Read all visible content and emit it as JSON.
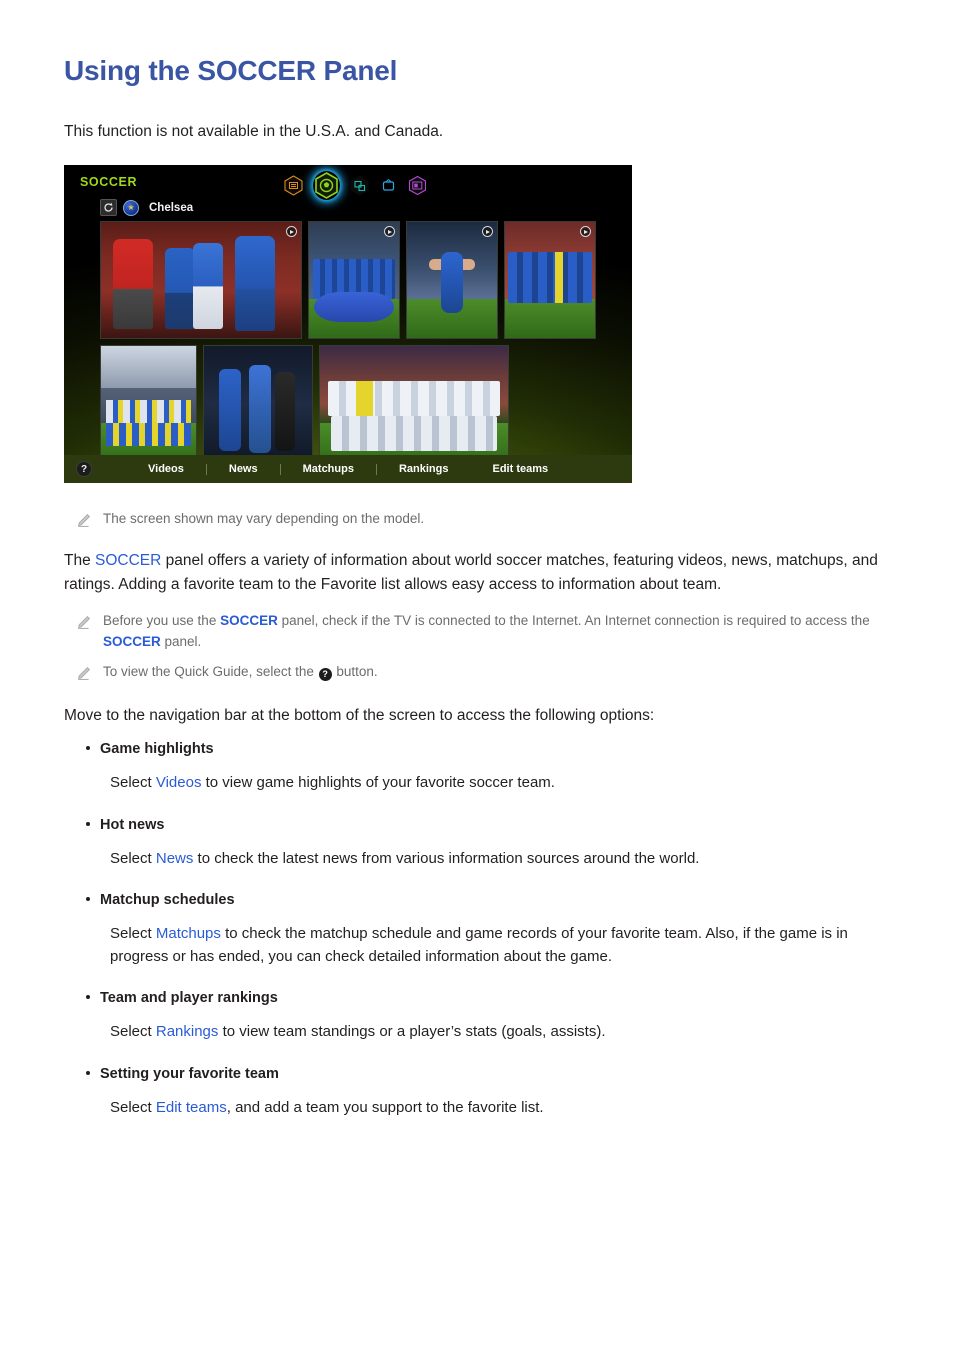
{
  "page": {
    "title": "Using the SOCCER Panel",
    "intro": "This function is not available in the U.S.A. and Canada."
  },
  "accent_colors": {
    "heading_blue": "#3b55a5",
    "link_blue": "#2a5bd7",
    "note_gray": "#6c6c6c",
    "panel_logo_green": "#a2d916",
    "panel_nav_bg": "#2d3a10"
  },
  "tv_panel": {
    "logo": "SOCCER",
    "team_name": "Chelsea",
    "sync_icon": "refresh-icon",
    "crest_icon": "chelsea-crest-icon",
    "header_icons": [
      {
        "name": "news-hex-icon",
        "color": "#e08a16",
        "active": false
      },
      {
        "name": "soccer-ball-hex-icon",
        "color": "#8fd41c",
        "active": true
      },
      {
        "name": "apps-hex-icon",
        "color": "#1fb8a8",
        "active": false
      },
      {
        "name": "tv-hex-icon",
        "color": "#2aa8e0",
        "active": false
      },
      {
        "name": "multiscreen-hex-icon",
        "color": "#b44ad4",
        "active": false
      }
    ],
    "help_button": "?",
    "nav_items": [
      {
        "label": "Videos"
      },
      {
        "label": "News"
      },
      {
        "label": "Matchups"
      },
      {
        "label": "Rankings"
      },
      {
        "label": "Edit teams"
      }
    ],
    "thumbnails": [
      {
        "name": "thumb-match-highlight-large",
        "has_play_badge": true
      },
      {
        "name": "thumb-team-photo-banner",
        "has_play_badge": true
      },
      {
        "name": "thumb-goal-celebration",
        "has_play_badge": true
      },
      {
        "name": "thumb-lineup-red-crowd",
        "has_play_badge": true
      },
      {
        "name": "thumb-stadium-team-photo",
        "has_play_badge": false
      },
      {
        "name": "thumb-match-duel",
        "has_play_badge": false
      },
      {
        "name": "thumb-team-photo-white-kit",
        "has_play_badge": false
      },
      {
        "name": "thumb-placeholder-1",
        "has_play_badge": false
      },
      {
        "name": "thumb-placeholder-2",
        "has_play_badge": false
      }
    ]
  },
  "notes": {
    "screen_vary": "The screen shown may vary depending on the model.",
    "internet_part1": "Before you use the ",
    "internet_hl1": "SOCCER",
    "internet_part2": " panel, check if the TV is connected to the Internet. An Internet connection is required to access the ",
    "internet_hl2": "SOCCER",
    "internet_part3": " panel.",
    "quick_guide_part1": "To view the Quick Guide, select the ",
    "quick_guide_button": "?",
    "quick_guide_part2": " button."
  },
  "body": {
    "para_part1": "The ",
    "para_hl": "SOCCER",
    "para_part2": " panel offers a variety of information about world soccer matches, featuring videos, news, matchups, and ratings. Adding a favorite team to the Favorite list allows easy access to information about team.",
    "lead_line": "Move to the navigation bar at the bottom of the screen to access the following options:"
  },
  "bullets": [
    {
      "title": "Game highlights",
      "body_part1": "Select ",
      "body_hl": "Videos",
      "body_part2": " to view game highlights of your favorite soccer team."
    },
    {
      "title": "Hot news",
      "body_part1": "Select ",
      "body_hl": "News",
      "body_part2": " to check the latest news from various information sources around the world."
    },
    {
      "title": "Matchup schedules",
      "body_part1": "Select ",
      "body_hl": "Matchups",
      "body_part2": " to check the matchup schedule and game records of your favorite team. Also, if the game is in progress or has ended, you can check detailed information about the game."
    },
    {
      "title": "Team and player rankings",
      "body_part1": "Select ",
      "body_hl": "Rankings",
      "body_part2": " to view team standings or a player’s stats (goals, assists)."
    },
    {
      "title": "Setting your favorite team",
      "body_part1": "Select ",
      "body_hl": "Edit teams",
      "body_part2": ", and add a team you support to the favorite list."
    }
  ]
}
